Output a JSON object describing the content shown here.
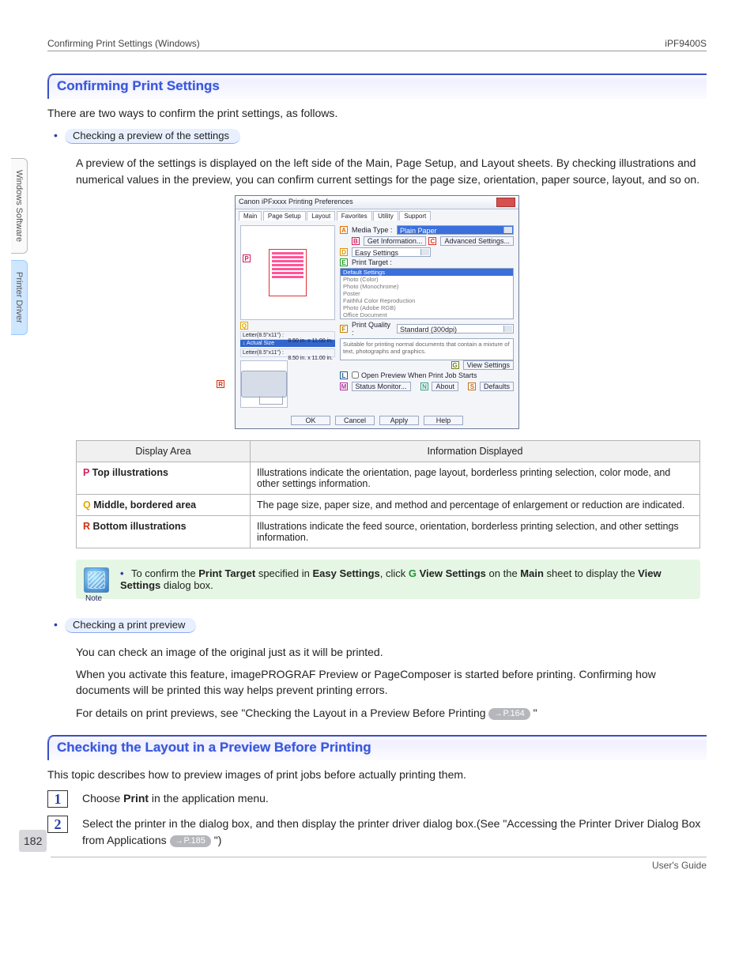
{
  "header": {
    "left": "Confirming Print Settings (Windows)",
    "right": "iPF9400S"
  },
  "side_tabs": [
    "Windows Software",
    "Printer Driver"
  ],
  "section1": {
    "title": "Confirming Print Settings",
    "intro": "There are two ways to confirm the print settings, as follows.",
    "bullet1": "Checking a preview of the settings",
    "bullet1_text": "A preview of the settings is displayed on the left side of the Main, Page Setup, and Layout sheets. By checking illustrations and numerical values in the preview, you can confirm current settings for the page size, orientation, paper source, layout, and so on."
  },
  "dialog": {
    "title": "Canon iPFxxxx Printing Preferences",
    "tabs": [
      "Main",
      "Page Setup",
      "Layout",
      "Favorites",
      "Utility",
      "Support"
    ],
    "media_type_label": "Media Type :",
    "media_type_value": "Plain Paper",
    "get_info": "Get Information...",
    "adv_settings": "Advanced Settings...",
    "easy_settings": "Easy Settings",
    "print_target_label": "Print Target :",
    "targets": [
      "Default Settings",
      "Photo (Color)",
      "Photo (Monochrome)",
      "Poster",
      "Faithful Color Reproduction",
      "Photo (Adobe RGB)",
      "Office Document"
    ],
    "print_quality_label": "Print Quality :",
    "print_quality_value": "Standard (300dpi)",
    "desc": "Suitable for printing normal documents that contain a mixture of text, photographs and graphics.",
    "view_settings": "View Settings",
    "open_preview_label": "Open Preview When Print Job Starts",
    "status_monitor": "Status Monitor...",
    "about": "About",
    "defaults": "Defaults",
    "bottom": [
      "OK",
      "Cancel",
      "Apply",
      "Help"
    ],
    "letter1": "Letter(8.5\"x11\") :",
    "letter_dim": "8.50 in. x 11.00 in.",
    "actual_size": "↓   Actual Size",
    "letter2": "Letter(8.5\"x11\") :"
  },
  "table": {
    "headers": [
      "Display Area",
      "Information Displayed"
    ],
    "rows": [
      {
        "letter": "P",
        "label": "Top illustrations",
        "info": "Illustrations indicate the orientation, page layout, borderless printing selection, color mode, and other settings information."
      },
      {
        "letter": "Q",
        "label": "Middle, bordered area",
        "info": "The page size, paper size, and method and percentage of enlargement or reduction are indicated."
      },
      {
        "letter": "R",
        "label": "Bottom illustrations",
        "info": "Illustrations indicate the feed source, orientation, borderless printing selection, and other settings information."
      }
    ]
  },
  "note": {
    "label": "Note",
    "pre": "To confirm the ",
    "b1": "Print Target",
    "mid1": " specified in ",
    "b2": "Easy Settings",
    "mid2": ", click ",
    "g_letter": "G",
    "b3": "View Settings",
    "mid3": " on the ",
    "b4": "Main",
    "mid4": " sheet to display the ",
    "b5": "View Settings",
    "end": " dialog box."
  },
  "preview_section": {
    "bullet": "Checking a print preview",
    "l1": "You can check an image of the original just as it will be printed.",
    "l2": "When you activate this feature, imagePROGRAF Preview or PageComposer is started before printing. Confirming how documents will be printed this way helps prevent printing errors.",
    "l3_pre": "For details on print previews, see \"Checking the Layout in a Preview Before Printing ",
    "l3_ref": "P.164",
    "l3_post": " \""
  },
  "section2": {
    "title": "Checking the Layout in a Preview Before Printing",
    "intro": "This topic describes how to preview images of print jobs before actually printing them.",
    "steps": [
      {
        "n": "1",
        "pre": "Choose ",
        "b": "Print",
        "post": " in the application menu."
      },
      {
        "n": "2",
        "pre": "Select the printer in the dialog box, and then display the printer driver dialog box.(See \"Accessing the Printer Driver Dialog Box from Applications ",
        "ref": "P.185",
        "post": " \")"
      }
    ]
  },
  "page_number": "182",
  "footer": "User's Guide"
}
